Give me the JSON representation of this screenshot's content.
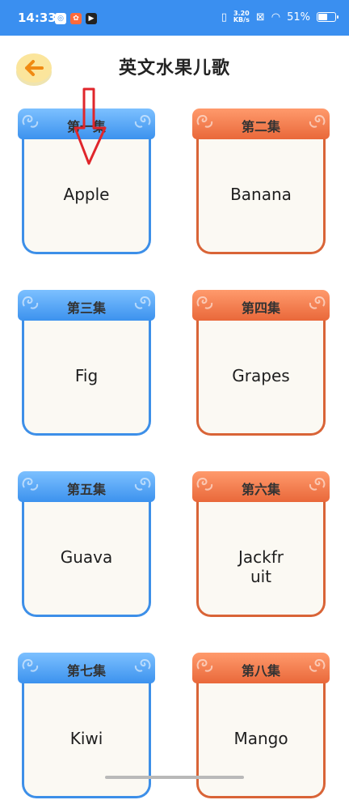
{
  "status": {
    "time": "14:33",
    "speed_top": "3.20",
    "speed_bottom": "KB/s",
    "battery": "51%",
    "battery_level": 0.51
  },
  "header": {
    "title": "英文水果儿歌"
  },
  "episodes": [
    {
      "episode": "第一集",
      "name": "Apple",
      "color": "blue"
    },
    {
      "episode": "第二集",
      "name": "Banana",
      "color": "orange"
    },
    {
      "episode": "第三集",
      "name": "Fig",
      "color": "blue"
    },
    {
      "episode": "第四集",
      "name": "Grapes",
      "color": "orange"
    },
    {
      "episode": "第五集",
      "name": "Guava",
      "color": "blue"
    },
    {
      "episode": "第六集",
      "name": "Jackfr\nuit",
      "color": "orange"
    },
    {
      "episode": "第七集",
      "name": "Kiwi",
      "color": "blue"
    },
    {
      "episode": "第八集",
      "name": "Mango",
      "color": "orange"
    }
  ],
  "colors": {
    "statusbar": "#3a8ff0",
    "blue": "#3d8fe8",
    "orange": "#e9683a",
    "back_button": "#fbe59c",
    "annotation": "#e0262b"
  },
  "icons": {
    "back": "arrow-left-icon",
    "annotation": "down-arrow-annotation-icon"
  }
}
